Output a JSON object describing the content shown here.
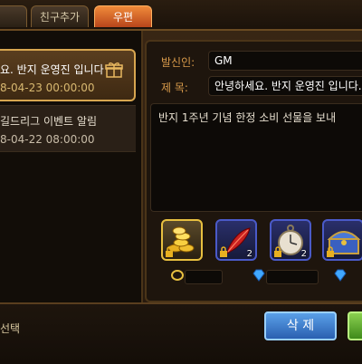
{
  "tabs": [
    {
      "label": ""
    },
    {
      "label": "친구추가"
    },
    {
      "label": "우편"
    }
  ],
  "mail_list": [
    {
      "title": "요. 반지 운영진 입니다",
      "date": "8-04-23 00:00:00",
      "has_gift": true
    },
    {
      "title": "길드리그 이벤트 알림",
      "date": "8-04-22 08:00:00",
      "has_gift": false
    }
  ],
  "detail": {
    "sender_label": "발신인:",
    "sender": "GM",
    "subject_label": "제 목:",
    "subject": "안녕하세요. 반지 운영진 입니다.",
    "body": "반지 1주년 기념 한정 소비 선물을 보내"
  },
  "items": [
    {
      "name": "gold-coins",
      "count": ""
    },
    {
      "name": "red-feather",
      "count": "2"
    },
    {
      "name": "pocket-watch",
      "count": "2"
    },
    {
      "name": "treasure-chest",
      "count": ""
    }
  ],
  "footer": {
    "select_label": "선택",
    "delete_label": "삭 제"
  },
  "colors": {
    "accent_tab": "#f08a3a",
    "delete_button": "#2a5fb0",
    "label_text": "#d89a4a"
  }
}
